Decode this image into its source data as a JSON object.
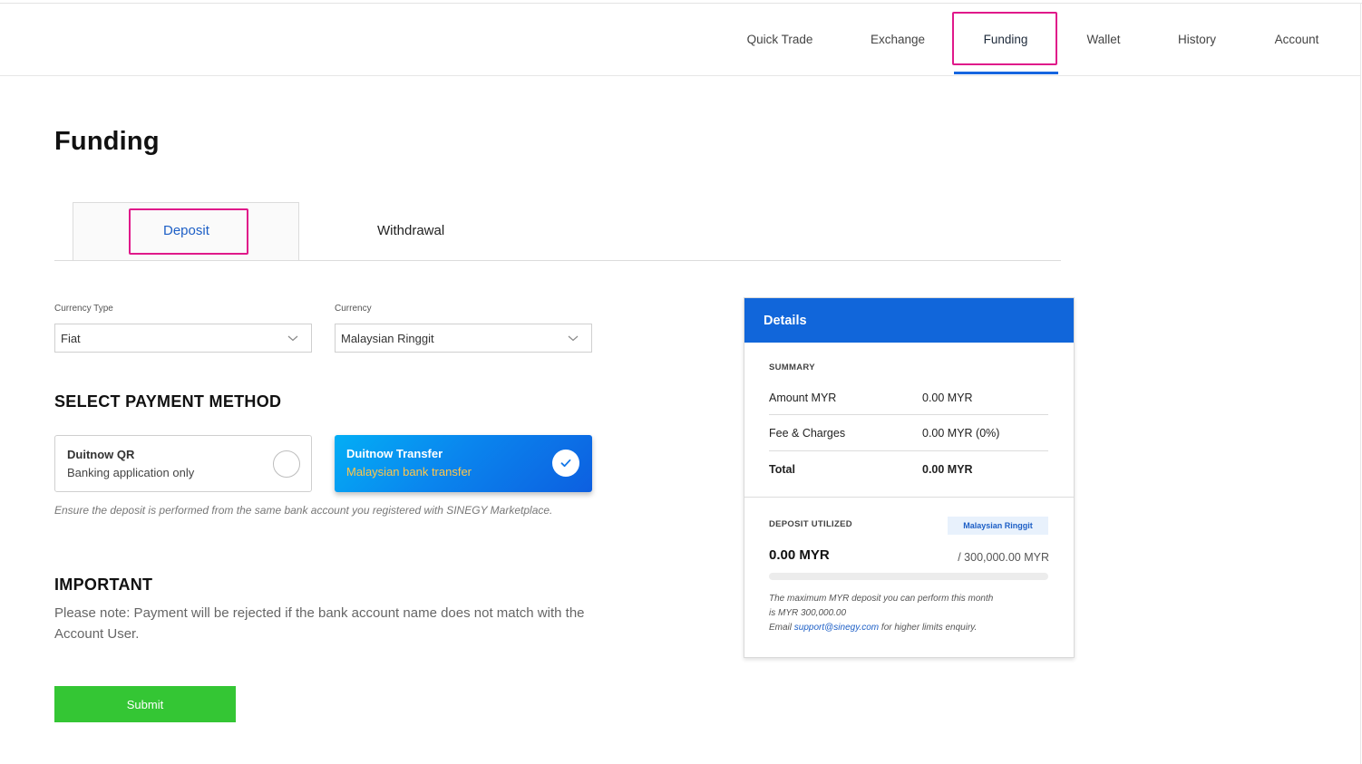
{
  "nav": {
    "items": [
      {
        "label": "Quick Trade"
      },
      {
        "label": "Exchange"
      },
      {
        "label": "Funding"
      },
      {
        "label": "Wallet"
      },
      {
        "label": "History"
      },
      {
        "label": "Account"
      }
    ],
    "active": "Funding"
  },
  "page": {
    "title": "Funding"
  },
  "tabs": {
    "deposit": "Deposit",
    "withdrawal": "Withdrawal",
    "active": "Deposit"
  },
  "form": {
    "currency_type": {
      "label": "Currency Type",
      "value": "Fiat"
    },
    "currency": {
      "label": "Currency",
      "value": "Malaysian Ringgit"
    }
  },
  "payment": {
    "title": "SELECT PAYMENT METHOD",
    "methods": [
      {
        "title": "Duitnow QR",
        "subtitle": "Banking application only",
        "selected": false
      },
      {
        "title": "Duitnow Transfer",
        "subtitle": "Malaysian bank transfer",
        "selected": true
      }
    ],
    "note": "Ensure the deposit is performed from the same bank account you registered with SINEGY Marketplace."
  },
  "important": {
    "title": "IMPORTANT",
    "text": "Please note: Payment will be rejected if the bank account name does not match with the Account User."
  },
  "submit": {
    "label": "Submit"
  },
  "details": {
    "title": "Details",
    "summary_heading": "SUMMARY",
    "rows": [
      {
        "label": "Amount MYR",
        "value": "0.00 MYR"
      },
      {
        "label": "Fee & Charges",
        "value": "0.00 MYR (0%)"
      },
      {
        "label": "Total",
        "value": "0.00 MYR"
      }
    ],
    "deposit_utilized": {
      "heading": "DEPOSIT UTILIZED",
      "badge": "Malaysian Ringgit",
      "amount": "0.00 MYR",
      "limit": "/ 300,000.00 MYR",
      "progress_fraction": 0
    },
    "note": {
      "line1": "The maximum MYR deposit you can perform this month",
      "line2": "is MYR 300,000.00",
      "email_prefix": "Email ",
      "email": "support@sinegy.com",
      "email_suffix": " for higher limits enquiry."
    }
  },
  "colors": {
    "accent": "#1166da",
    "highlight": "#e0198a",
    "submit": "#34c634",
    "gold": "#ffc64b"
  }
}
